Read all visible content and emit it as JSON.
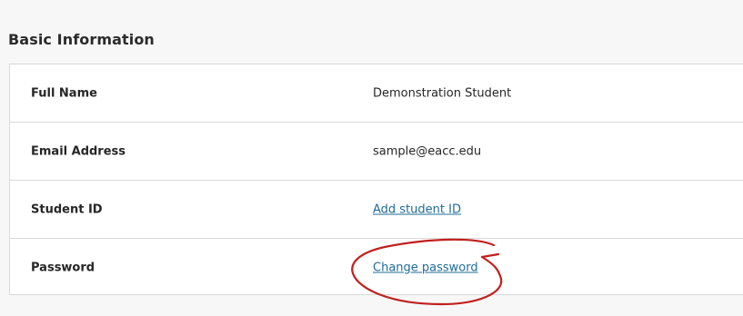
{
  "section": {
    "title": "Basic Information"
  },
  "rows": [
    {
      "label": "Full Name",
      "value": "Demonstration Student"
    },
    {
      "label": "Email Address",
      "value": "sample@eacc.edu"
    },
    {
      "label": "Student ID",
      "value": "Add student ID"
    },
    {
      "label": "Password",
      "value": "Change password"
    }
  ],
  "colors": {
    "link": "#1f6b96",
    "annotation": "#c0201e",
    "border": "#d9d9d9"
  }
}
